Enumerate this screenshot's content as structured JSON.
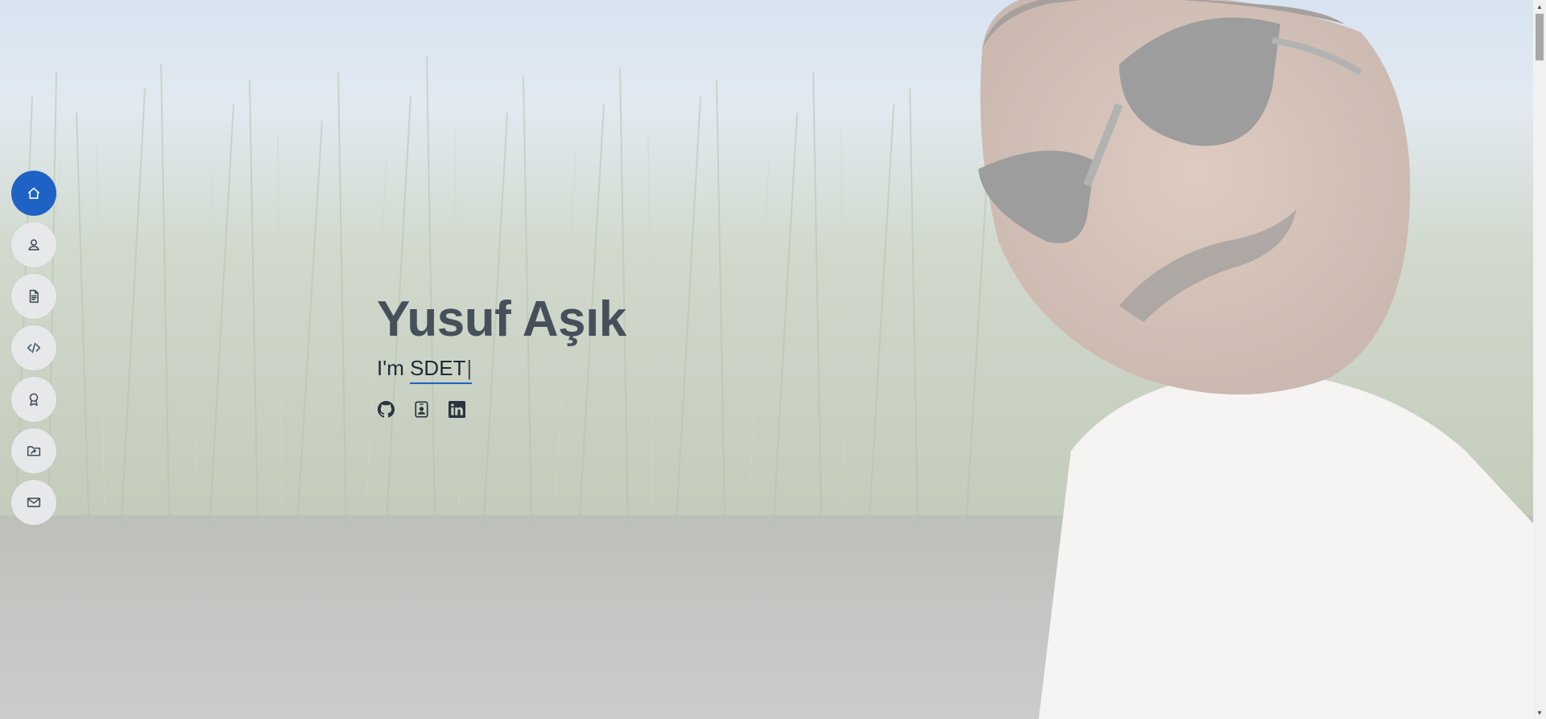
{
  "hero": {
    "name": "Yusuf Aşık",
    "tagline_prefix": "I'm",
    "typed_text": "SDET",
    "cursor": "|"
  },
  "nav": {
    "items": [
      {
        "id": "home",
        "icon": "home-icon",
        "active": true
      },
      {
        "id": "about",
        "icon": "person-icon",
        "active": false
      },
      {
        "id": "resume",
        "icon": "file-text-icon",
        "active": false
      },
      {
        "id": "skills",
        "icon": "code-slash-icon",
        "active": false
      },
      {
        "id": "certificates",
        "icon": "award-icon",
        "active": false
      },
      {
        "id": "portfolio",
        "icon": "folder-symlink-icon",
        "active": false
      },
      {
        "id": "contact",
        "icon": "envelope-icon",
        "active": false
      }
    ]
  },
  "social": [
    {
      "id": "github",
      "icon": "github-icon"
    },
    {
      "id": "contact-card",
      "icon": "person-badge-icon"
    },
    {
      "id": "linkedin",
      "icon": "linkedin-icon"
    }
  ],
  "colors": {
    "accent": "#1f62c6",
    "heading": "#45505b",
    "nav_bg": "#e6e8ea"
  }
}
